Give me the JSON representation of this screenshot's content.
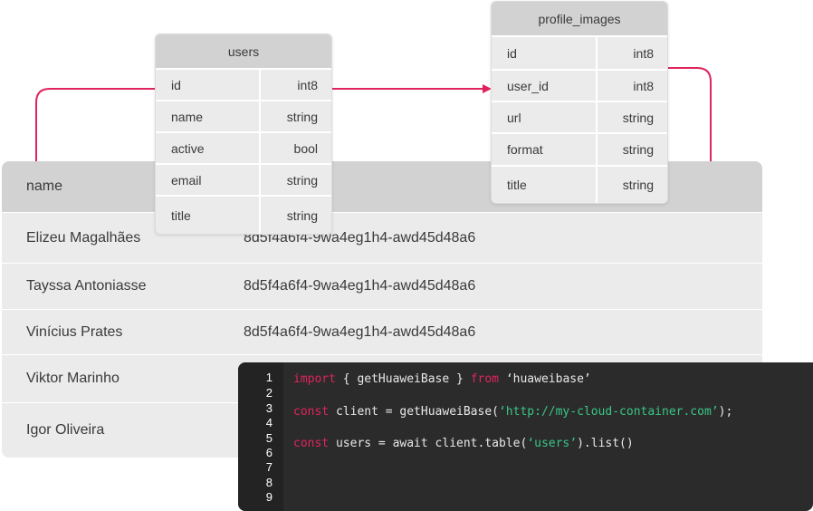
{
  "data_table": {
    "header": {
      "name": "name"
    },
    "rows": [
      {
        "name": "Elizeu Magalhães",
        "id": "8d5f4a6f4-9wa4eg1h4-awd45d48a6"
      },
      {
        "name": "Tayssa Antoniasse",
        "id": "8d5f4a6f4-9wa4eg1h4-awd45d48a6"
      },
      {
        "name": "Vinícius Prates",
        "id": "8d5f4a6f4-9wa4eg1h4-awd45d48a6"
      },
      {
        "name": "Viktor Marinho",
        "id": ""
      },
      {
        "name": "Igor Oliveira",
        "id": ""
      }
    ]
  },
  "users_schema": {
    "title": "users",
    "fields": [
      {
        "name": "id",
        "type": "int8"
      },
      {
        "name": "name",
        "type": "string"
      },
      {
        "name": "active",
        "type": "bool"
      },
      {
        "name": "email",
        "type": "string"
      },
      {
        "name": "title",
        "type": "string"
      }
    ]
  },
  "profile_images_schema": {
    "title": "profile_images",
    "fields": [
      {
        "name": "id",
        "type": "int8"
      },
      {
        "name": "user_id",
        "type": "int8"
      },
      {
        "name": "url",
        "type": "string"
      },
      {
        "name": "format",
        "type": "string"
      },
      {
        "name": "title",
        "type": "string"
      }
    ]
  },
  "code_editor": {
    "line_numbers": [
      "1",
      "2",
      "3",
      "4",
      "5",
      "6",
      "7",
      "8",
      "9"
    ],
    "line1": {
      "kw_import": "import",
      "brace_open": " { getHuaweiBase } ",
      "kw_from": "from",
      "module": " ‘huaweibase’"
    },
    "line3": {
      "kw_const": "const",
      "expr": " client = getHuaweiBase(",
      "url": "‘http://my-cloud-container.com’",
      "end": ");"
    },
    "line5": {
      "kw_const": "const",
      "expr": " users = await client.table(",
      "table": "‘users’",
      "end": ").list()"
    }
  },
  "colors": {
    "relation_line": "#e0245e",
    "keyword": "#e0245e",
    "string": "#39c586",
    "editor_bg": "#2b2b2b",
    "header_bg": "#d2d2d2",
    "row_bg": "#ebebeb"
  }
}
